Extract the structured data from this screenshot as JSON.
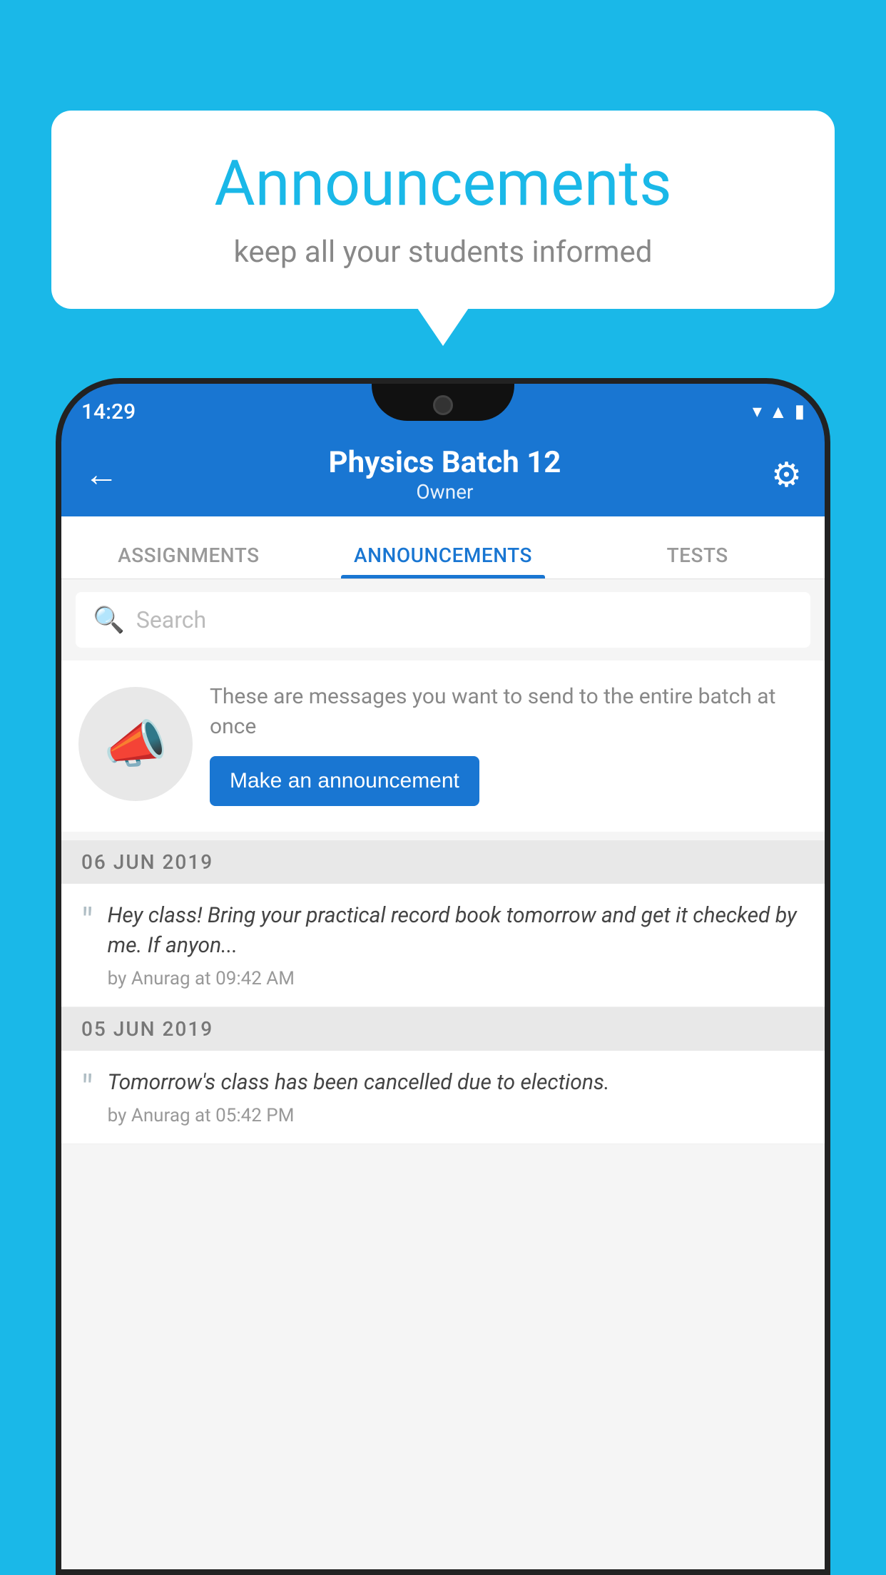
{
  "background": {
    "color": "#1ab8e8"
  },
  "speech_bubble": {
    "title": "Announcements",
    "subtitle": "keep all your students informed"
  },
  "phone": {
    "status_bar": {
      "time": "14:29",
      "icons": [
        "wifi",
        "signal",
        "battery"
      ]
    },
    "header": {
      "title": "Physics Batch 12",
      "subtitle": "Owner",
      "back_label": "←",
      "settings_label": "⚙"
    },
    "tabs": [
      {
        "label": "ASSIGNMENTS",
        "active": false
      },
      {
        "label": "ANNOUNCEMENTS",
        "active": true
      },
      {
        "label": "TESTS",
        "active": false
      }
    ],
    "search": {
      "placeholder": "Search"
    },
    "announcement_prompt": {
      "description": "These are messages you want to send to the entire batch at once",
      "button_label": "Make an announcement"
    },
    "announcements": [
      {
        "date": "06  JUN  2019",
        "message": "Hey class! Bring your practical record book tomorrow and get it checked by me. If anyon...",
        "meta": "by Anurag at 09:42 AM"
      },
      {
        "date": "05  JUN  2019",
        "message": "Tomorrow's class has been cancelled due to elections.",
        "meta": "by Anurag at 05:42 PM"
      }
    ]
  }
}
